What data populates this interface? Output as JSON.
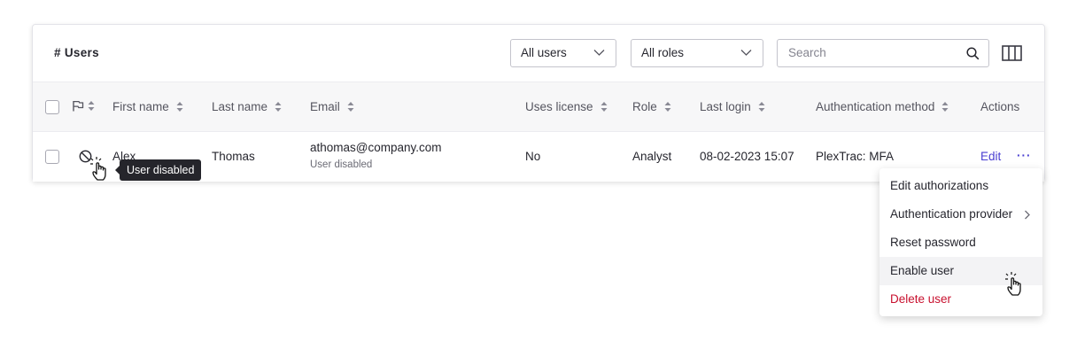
{
  "header": {
    "title": "# Users",
    "filter_users": "All users",
    "filter_roles": "All roles",
    "search_placeholder": "Search"
  },
  "columns": {
    "first_name": "First name",
    "last_name": "Last name",
    "email": "Email",
    "uses_license": "Uses license",
    "role": "Role",
    "last_login": "Last login",
    "auth_method": "Authentication method",
    "actions": "Actions"
  },
  "row": {
    "status_icon": "disabled-icon",
    "first_name": "Alex",
    "last_name": "Thomas",
    "email": "athomas@company.com",
    "email_sub": "User disabled",
    "uses_license": "No",
    "role": "Analyst",
    "last_login": "08-02-2023 15:07",
    "auth_method": "PlexTrac: MFA",
    "edit": "Edit",
    "more": "···"
  },
  "tooltip": "User disabled",
  "menu": {
    "items": [
      "Edit authorizations",
      "Authentication provider",
      "Reset password",
      "Enable user",
      "Delete user"
    ]
  },
  "colors": {
    "accent": "#4a3fd1",
    "danger": "#c8102e",
    "tooltip_bg": "#25252b"
  }
}
